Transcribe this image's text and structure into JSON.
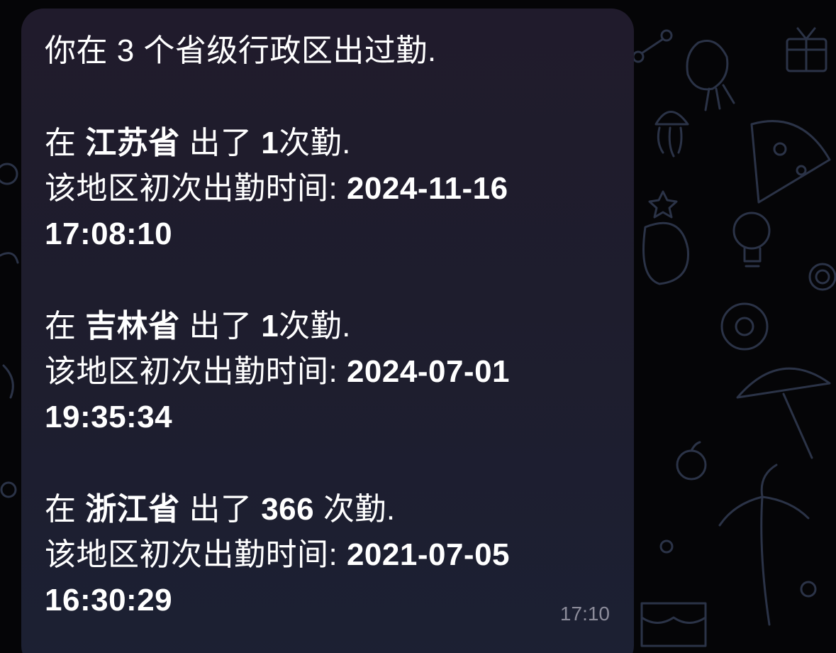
{
  "message": {
    "intro": "你在 3 个省级行政区出过勤.",
    "entries": [
      {
        "prefix": "在 ",
        "province": "江苏省",
        "mid": " 出了 ",
        "count": "1",
        "suffix": "次勤.",
        "first_label": "该地区初次出勤时间: ",
        "first_date": "2024-11-16",
        "first_time": "17:08:10"
      },
      {
        "prefix": "在 ",
        "province": "吉林省",
        "mid": " 出了 ",
        "count": "1",
        "suffix": "次勤.",
        "first_label": "该地区初次出勤时间: ",
        "first_date": "2024-07-01",
        "first_time": "19:35:34"
      },
      {
        "prefix": "在 ",
        "province": "浙江省",
        "mid": " 出了 ",
        "count": "366",
        "suffix": " 次勤.",
        "first_label": "该地区初次出勤时间: ",
        "first_date": "2021-07-05",
        "first_time": "16:30:29"
      }
    ],
    "timestamp": "17:10"
  },
  "colors": {
    "background": "#050507",
    "bubble": "#1e1d2d",
    "text": "#ffffff",
    "timestamp": "#8c8c9a",
    "doodle": "#2b3347"
  },
  "icons": [
    "doodle-pattern-background"
  ]
}
